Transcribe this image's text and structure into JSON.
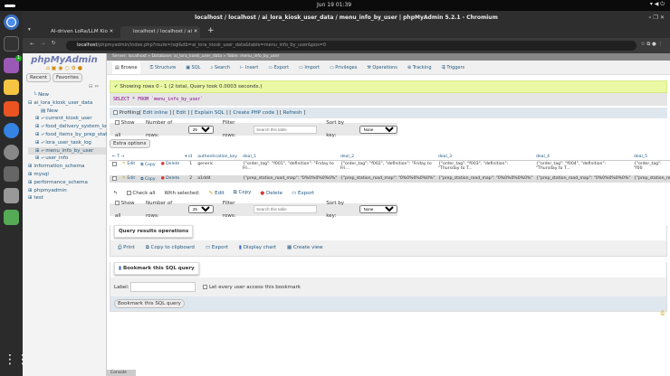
{
  "system": {
    "clock": "Jun 19  01:39"
  },
  "window": {
    "title": "localhost / localhost / ai_lora_kiosk_user_data / menu_info_by_user | phpMyAdmin 5.2.1 - Chromium"
  },
  "tabs": [
    {
      "label": "AI-driven LoRa/LLM Kio"
    },
    {
      "label": "localhost / localhost / ai"
    }
  ],
  "address": {
    "host": "localhost",
    "path": "/phpmyadmin/index.php?route=/sql&db=ai_lora_kiosk_user_data&table=menu_info_by_user&pos=0"
  },
  "dock": {
    "badge": "1"
  },
  "sidebar": {
    "logo": "phpMyAdmin",
    "recent": "Recent",
    "favorites": "Favorites",
    "tree": [
      "New",
      "ai_lora_kiosk_user_data",
      "New",
      "current_kiosk_user",
      "food_delivery_system_log",
      "food_items_by_prep_station",
      "lora_user_task_log",
      "menu_info_by_user",
      "user_info",
      "information_schema",
      "mysql",
      "performance_schema",
      "phpmyadmin",
      "test"
    ]
  },
  "breadcrumb": {
    "server": "Server: localhost",
    "database": "Database: ai_lora_kiosk_user_data",
    "table": "Table: menu_info_by_user"
  },
  "menu": [
    "Browse",
    "Structure",
    "SQL",
    "Search",
    "Insert",
    "Export",
    "Import",
    "Privileges",
    "Operations",
    "Tracking",
    "Triggers"
  ],
  "message": "Showing rows 0 - 1 (2 total, Query took 0.0003 seconds.)",
  "sql": "SELECT * FROM `menu_info_by_user`",
  "profiling": {
    "label": "Profiling",
    "links": [
      "Edit inline",
      "Edit",
      "Explain SQL",
      "Create PHP code",
      "Refresh"
    ]
  },
  "nav": {
    "show_all": "Show all",
    "rows_label": "Number of rows:",
    "rows": "25",
    "filter_label": "Filter rows:",
    "filter_placeholder": "Search this table",
    "sort_label": "Sort by key:",
    "sort": "None"
  },
  "extra_options": "Extra options",
  "table": {
    "columns": [
      "id",
      "authentication_key",
      "deal_1",
      "deal_2",
      "deal_3",
      "deal_4",
      "deal_5"
    ],
    "actions": {
      "edit": "Edit",
      "copy": "Copy",
      "delete": "Delete"
    },
    "rows": [
      [
        "1",
        "generic",
        "{\"order_tag\": \"f001\", \"definition\": \"Friday to Fri...",
        "{\"order_tag\": \"f002\", \"definition\": \"Friday to Fri...",
        "{\"order_tag\": \"f003\", \"definition\": \"Thursday to T...",
        "{\"order_tag\": \"f004\", \"definition\": \"Thursday to T...",
        "{\"order_tag\": \"f00"
      ],
      [
        "2",
        "a1dd4",
        "{\"prep_station_road_map\": \"0%0%0%0%0%\"}",
        "{\"prep_station_road_map\": \"0%0%0%0%0%\"}",
        "{\"prep_station_road_map\": \"0%0%0%0%0%\"}",
        "{\"prep_station_road_map\": \"0%0%0%0%0%\"}",
        "{\"prep_station_ro"
      ]
    ]
  },
  "bulk": {
    "check_all": "Check all",
    "with_selected": "With selected:",
    "edit": "Edit",
    "copy": "Copy",
    "delete": "Delete",
    "export": "Export"
  },
  "ops": {
    "legend": "Query results operations",
    "items": [
      "Print",
      "Copy to clipboard",
      "Export",
      "Display chart",
      "Create view"
    ]
  },
  "bookmark": {
    "legend": "Bookmark this SQL query",
    "label": "Label:",
    "checkbox": "Let every user access this bookmark",
    "button": "Bookmark this SQL query"
  },
  "console": "Console"
}
